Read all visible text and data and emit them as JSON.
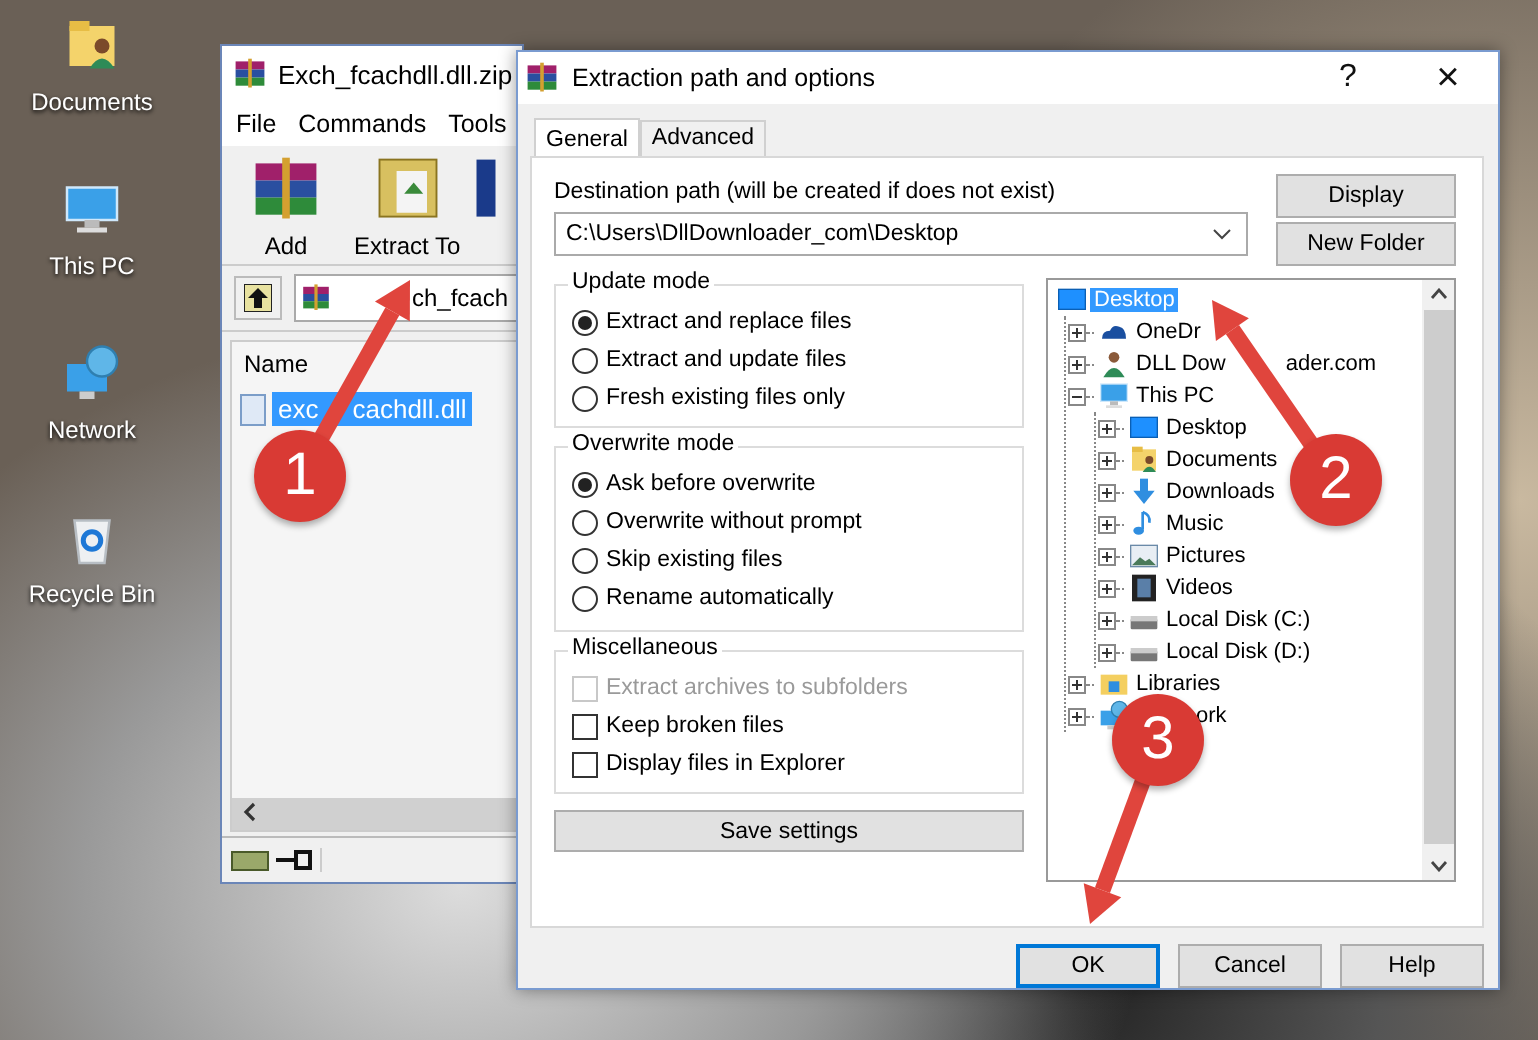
{
  "desktop_icons": [
    {
      "label": "Documents",
      "kind": "documents"
    },
    {
      "label": "This PC",
      "kind": "pc"
    },
    {
      "label": "Network",
      "kind": "network"
    },
    {
      "label": "Recycle Bin",
      "kind": "recycle"
    }
  ],
  "archive_window": {
    "title": "Exch_fcachdll.dll.zip",
    "menu": [
      "File",
      "Commands",
      "Tools"
    ],
    "toolbar": [
      {
        "label": "Add",
        "kind": "add"
      },
      {
        "label": "Extract To",
        "kind": "extract"
      },
      {
        "kind": "book"
      }
    ],
    "address": "ch_fcach",
    "address_partly_hidden": true,
    "columns": [
      "Name"
    ],
    "files": [
      {
        "name": "exc",
        "name_rest": "cachdll.dll",
        "selected": true
      }
    ]
  },
  "dialog": {
    "title": "Extraction path and options",
    "help": "?",
    "close": "×",
    "tabs": [
      {
        "label": "General",
        "selected": true
      },
      {
        "label": "Advanced",
        "selected": false
      }
    ],
    "destination_label": "Destination path (will be created if does not exist)",
    "destination_path": "C:\\Users\\DllDownloader_com\\Desktop",
    "side_buttons": [
      "Display",
      "New Folder"
    ],
    "groups": [
      {
        "title": "Update mode",
        "options": [
          {
            "label": "Extract and replace files",
            "kind": "radio",
            "selected": true
          },
          {
            "label": "Extract and update files",
            "kind": "radio",
            "selected": false
          },
          {
            "label": "Fresh existing files only",
            "kind": "radio",
            "selected": false
          }
        ]
      },
      {
        "title": "Overwrite mode",
        "options": [
          {
            "label": "Ask before overwrite",
            "kind": "radio",
            "selected": true
          },
          {
            "label": "Overwrite without prompt",
            "kind": "radio",
            "selected": false
          },
          {
            "label": "Skip existing files",
            "kind": "radio",
            "selected": false
          },
          {
            "label": "Rename automatically",
            "kind": "radio",
            "selected": false
          }
        ]
      },
      {
        "title": "Miscellaneous",
        "options": [
          {
            "label": "Extract archives to subfolders",
            "kind": "checkbox",
            "checked": false,
            "disabled": true
          },
          {
            "label": "Keep broken files",
            "kind": "checkbox",
            "checked": false,
            "disabled": false
          },
          {
            "label": "Display files in Explorer",
            "kind": "checkbox",
            "checked": false,
            "disabled": false
          }
        ]
      }
    ],
    "save_button": "Save settings",
    "tree": [
      {
        "label": "Desktop",
        "kind": "desktop",
        "selected": true,
        "children": [
          {
            "label": "OneDr",
            "kind": "cloud",
            "selected": false,
            "expanded": false
          },
          {
            "label": "DLL Dow",
            "label_rest": "ader.com",
            "kind": "user",
            "selected": false,
            "expanded": false
          },
          {
            "label": "This PC",
            "kind": "pc",
            "selected": false,
            "expanded": true,
            "children": [
              {
                "label": "Desktop",
                "kind": "desktop",
                "selected": false,
                "expanded": false
              },
              {
                "label": "Documents",
                "kind": "documents",
                "selected": false,
                "expanded": false
              },
              {
                "label": "Downloads",
                "kind": "downloads",
                "selected": false,
                "expanded": false
              },
              {
                "label": "Music",
                "kind": "music",
                "selected": false,
                "expanded": false
              },
              {
                "label": "Pictures",
                "kind": "pictures",
                "selected": false,
                "expanded": false
              },
              {
                "label": "Videos",
                "kind": "videos",
                "selected": false,
                "expanded": false
              },
              {
                "label": "Local Disk (C:)",
                "kind": "disk",
                "selected": false,
                "expanded": false
              },
              {
                "label": "Local Disk (D:)",
                "kind": "disk",
                "selected": false,
                "expanded": false
              }
            ]
          },
          {
            "label": "Libraries",
            "kind": "libraries",
            "selected": false,
            "expanded": false
          },
          {
            "label": "ork",
            "partly_hidden": true,
            "kind": "network",
            "selected": false,
            "expanded": false
          }
        ]
      }
    ],
    "buttons": [
      {
        "label": "OK",
        "default": true
      },
      {
        "label": "Cancel",
        "default": false
      },
      {
        "label": "Help",
        "default": false
      }
    ]
  },
  "annotations": [
    {
      "number": "1"
    },
    {
      "number": "2"
    },
    {
      "number": "3"
    }
  ]
}
